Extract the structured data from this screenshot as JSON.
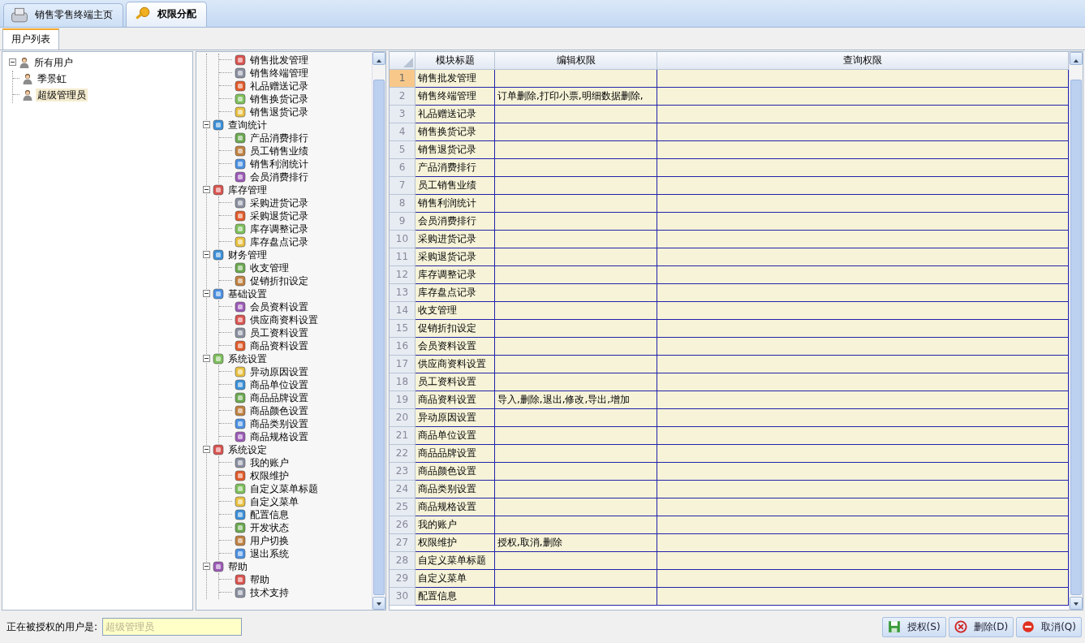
{
  "app_tabs": [
    {
      "label": "销售零售终端主页",
      "selected": false
    },
    {
      "label": "权限分配",
      "selected": true
    }
  ],
  "sub_tabs": [
    {
      "label": "用户列表",
      "selected": true
    }
  ],
  "user_tree": [
    {
      "label": "所有用户",
      "expanded": true,
      "selected": false,
      "children": [
        {
          "label": "季景虹",
          "selected": false
        },
        {
          "label": "超级管理员",
          "selected": true
        }
      ]
    }
  ],
  "module_tree": [
    {
      "children": [
        "销售批发管理",
        "销售终端管理",
        "礼品赠送记录",
        "销售换货记录",
        "销售退货记录"
      ]
    },
    {
      "label": "查询统计",
      "expanded": true,
      "children": [
        "产品消费排行",
        "员工销售业绩",
        "销售利润统计",
        "会员消费排行"
      ]
    },
    {
      "label": "库存管理",
      "expanded": true,
      "children": [
        "采购进货记录",
        "采购退货记录",
        "库存调整记录",
        "库存盘点记录"
      ]
    },
    {
      "label": "财务管理",
      "expanded": true,
      "children": [
        "收支管理",
        "促销折扣设定"
      ]
    },
    {
      "label": "基础设置",
      "expanded": true,
      "children": [
        "会员资料设置",
        "供应商资料设置",
        "员工资料设置",
        "商品资料设置"
      ]
    },
    {
      "label": "系统设置",
      "expanded": true,
      "children": [
        "异动原因设置",
        "商品单位设置",
        "商品品牌设置",
        "商品颜色设置",
        "商品类别设置",
        "商品规格设置"
      ]
    },
    {
      "label": "系统设定",
      "expanded": true,
      "children": [
        "我的账户",
        "权限维护",
        "自定义菜单标题",
        "自定义菜单",
        "配置信息",
        "开发状态",
        "用户切换",
        "退出系统"
      ]
    },
    {
      "label": "帮助",
      "expanded": true,
      "children": [
        "帮助",
        "技术支持"
      ]
    }
  ],
  "table": {
    "columns": [
      "模块标题",
      "编辑权限",
      "查询权限"
    ],
    "rows": [
      {
        "no": "1",
        "title": "销售批发管理",
        "selected": true
      },
      {
        "no": "2",
        "title": "销售终端管理",
        "edit": "订单删除,打印小票,明细数据删除,",
        "selected": false
      },
      {
        "no": "3",
        "title": "礼品赠送记录",
        "selected": false
      },
      {
        "no": "4",
        "title": "销售换货记录",
        "selected": false
      },
      {
        "no": "5",
        "title": "销售退货记录",
        "selected": false
      },
      {
        "no": "6",
        "title": "产品消费排行",
        "selected": false
      },
      {
        "no": "7",
        "title": "员工销售业绩",
        "selected": false
      },
      {
        "no": "8",
        "title": "销售利润统计",
        "selected": false
      },
      {
        "no": "9",
        "title": "会员消费排行",
        "selected": false
      },
      {
        "no": "10",
        "title": "采购进货记录",
        "selected": false
      },
      {
        "no": "11",
        "title": "采购退货记录",
        "selected": false
      },
      {
        "no": "12",
        "title": "库存调整记录",
        "selected": false
      },
      {
        "no": "13",
        "title": "库存盘点记录",
        "selected": false
      },
      {
        "no": "14",
        "title": "收支管理",
        "selected": false
      },
      {
        "no": "15",
        "title": "促销折扣设定",
        "selected": false
      },
      {
        "no": "16",
        "title": "会员资料设置",
        "selected": false
      },
      {
        "no": "17",
        "title": "供应商资料设置",
        "selected": false
      },
      {
        "no": "18",
        "title": "员工资料设置",
        "selected": false
      },
      {
        "no": "19",
        "title": "商品资料设置",
        "edit": "导入,删除,退出,修改,导出,增加",
        "selected": false
      },
      {
        "no": "20",
        "title": "异动原因设置",
        "selected": false
      },
      {
        "no": "21",
        "title": "商品单位设置",
        "selected": false
      },
      {
        "no": "22",
        "title": "商品品牌设置",
        "selected": false
      },
      {
        "no": "23",
        "title": "商品颜色设置",
        "selected": false
      },
      {
        "no": "24",
        "title": "商品类别设置",
        "selected": false
      },
      {
        "no": "25",
        "title": "商品规格设置",
        "selected": false
      },
      {
        "no": "26",
        "title": "我的账户",
        "selected": false
      },
      {
        "no": "27",
        "title": "权限维护",
        "edit": "授权,取消,删除",
        "selected": false
      },
      {
        "no": "28",
        "title": "自定义菜单标题",
        "selected": false
      },
      {
        "no": "29",
        "title": "自定义菜单",
        "selected": false
      },
      {
        "no": "30",
        "title": "配置信息",
        "selected": false
      }
    ]
  },
  "footer": {
    "user_label": "正在被授权的用户是:",
    "user_field": {
      "value": "超级管理员",
      "disabled": true
    },
    "buttons": [
      {
        "kind": "save",
        "label": "授权(S)"
      },
      {
        "kind": "delete",
        "label": "删除(D)"
      },
      {
        "kind": "cancel",
        "label": "取消(Q)"
      }
    ]
  }
}
